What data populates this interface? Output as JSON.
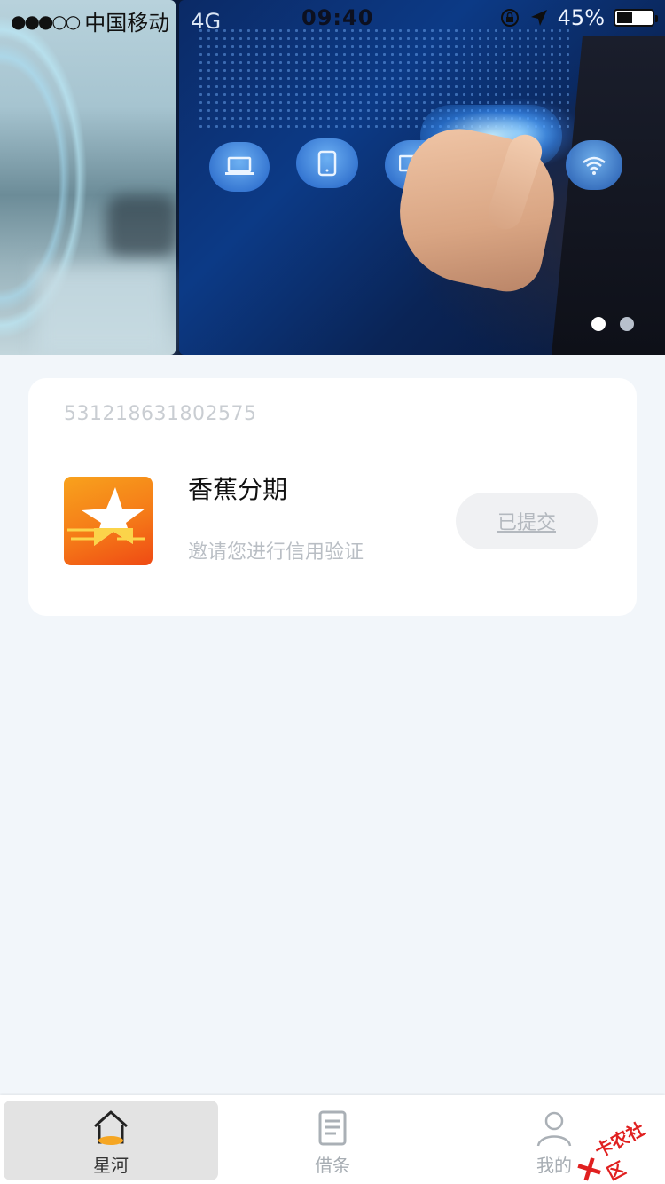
{
  "status_bar": {
    "carrier": "中国移动",
    "network": "4G",
    "time": "09:40",
    "battery": "45%",
    "battery_level": 0.45
  },
  "banner": {
    "slides_count": 2,
    "active_index": 0,
    "colors": {
      "active_dot": "#ffffff",
      "inactive_dot": "#b8c0cc"
    }
  },
  "card": {
    "order_id": "531218631802575",
    "app_name": "香蕉分期",
    "description": "邀请您进行信用验证",
    "status_label": "已提交",
    "icon": "star-app-icon"
  },
  "tabbar": {
    "items": [
      {
        "label": "星河",
        "icon": "home-icon",
        "active": true
      },
      {
        "label": "借条",
        "icon": "document-icon",
        "active": false
      },
      {
        "label": "我的",
        "icon": "user-icon",
        "active": false
      }
    ]
  },
  "watermark": {
    "text": "卡农社区"
  },
  "colors": {
    "page_bg": "#f2f6fa",
    "accent": "#f5a623",
    "muted_text": "#b9bec4"
  }
}
